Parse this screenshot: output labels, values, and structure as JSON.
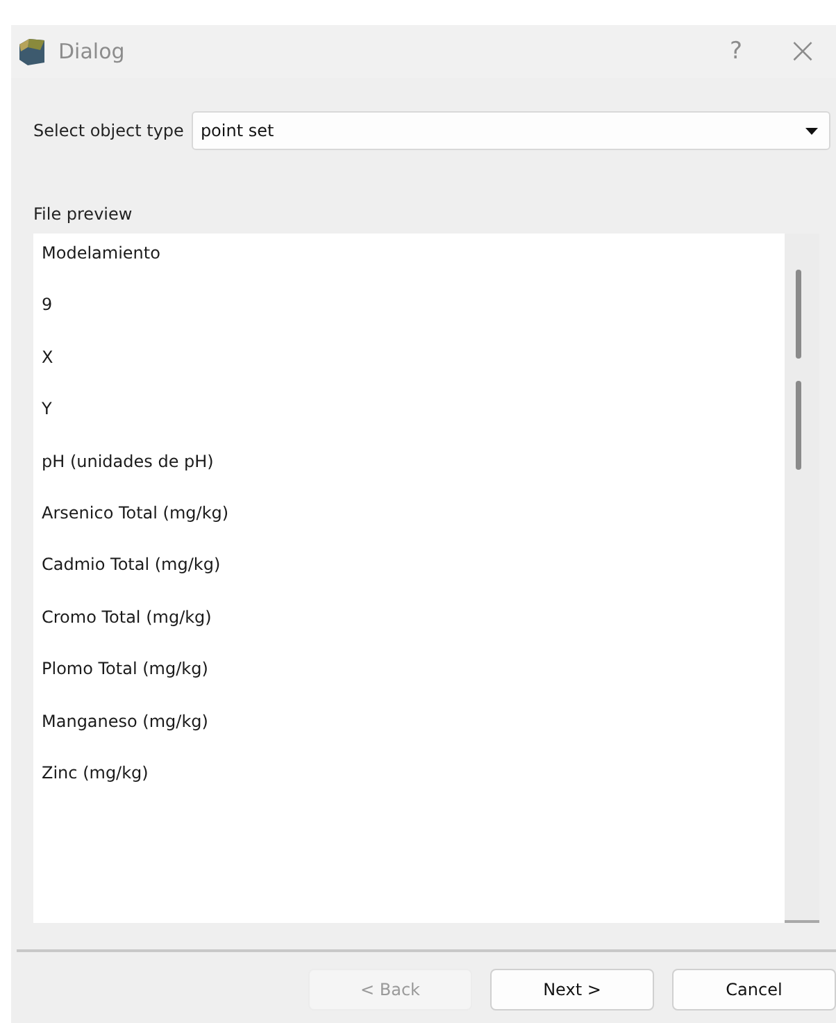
{
  "window": {
    "title": "Dialog",
    "help": "?",
    "close": "×"
  },
  "object_type": {
    "label": "Select object type",
    "value": "point set"
  },
  "preview": {
    "label": "File preview",
    "lines": [
      "Modelamiento",
      "9",
      "X",
      "Y",
      "pH (unidades de pH)",
      "Arsenico Total (mg/kg)",
      "Cadmio Total (mg/kg)",
      "Cromo Total (mg/kg)",
      "Plomo Total (mg/kg)",
      "Manganeso (mg/kg)",
      "Zinc (mg/kg)"
    ]
  },
  "buttons": [
    {
      "label": "< Back",
      "disabled": true
    },
    {
      "label": "Next >",
      "disabled": false
    },
    {
      "label": "Cancel",
      "disabled": false
    }
  ]
}
